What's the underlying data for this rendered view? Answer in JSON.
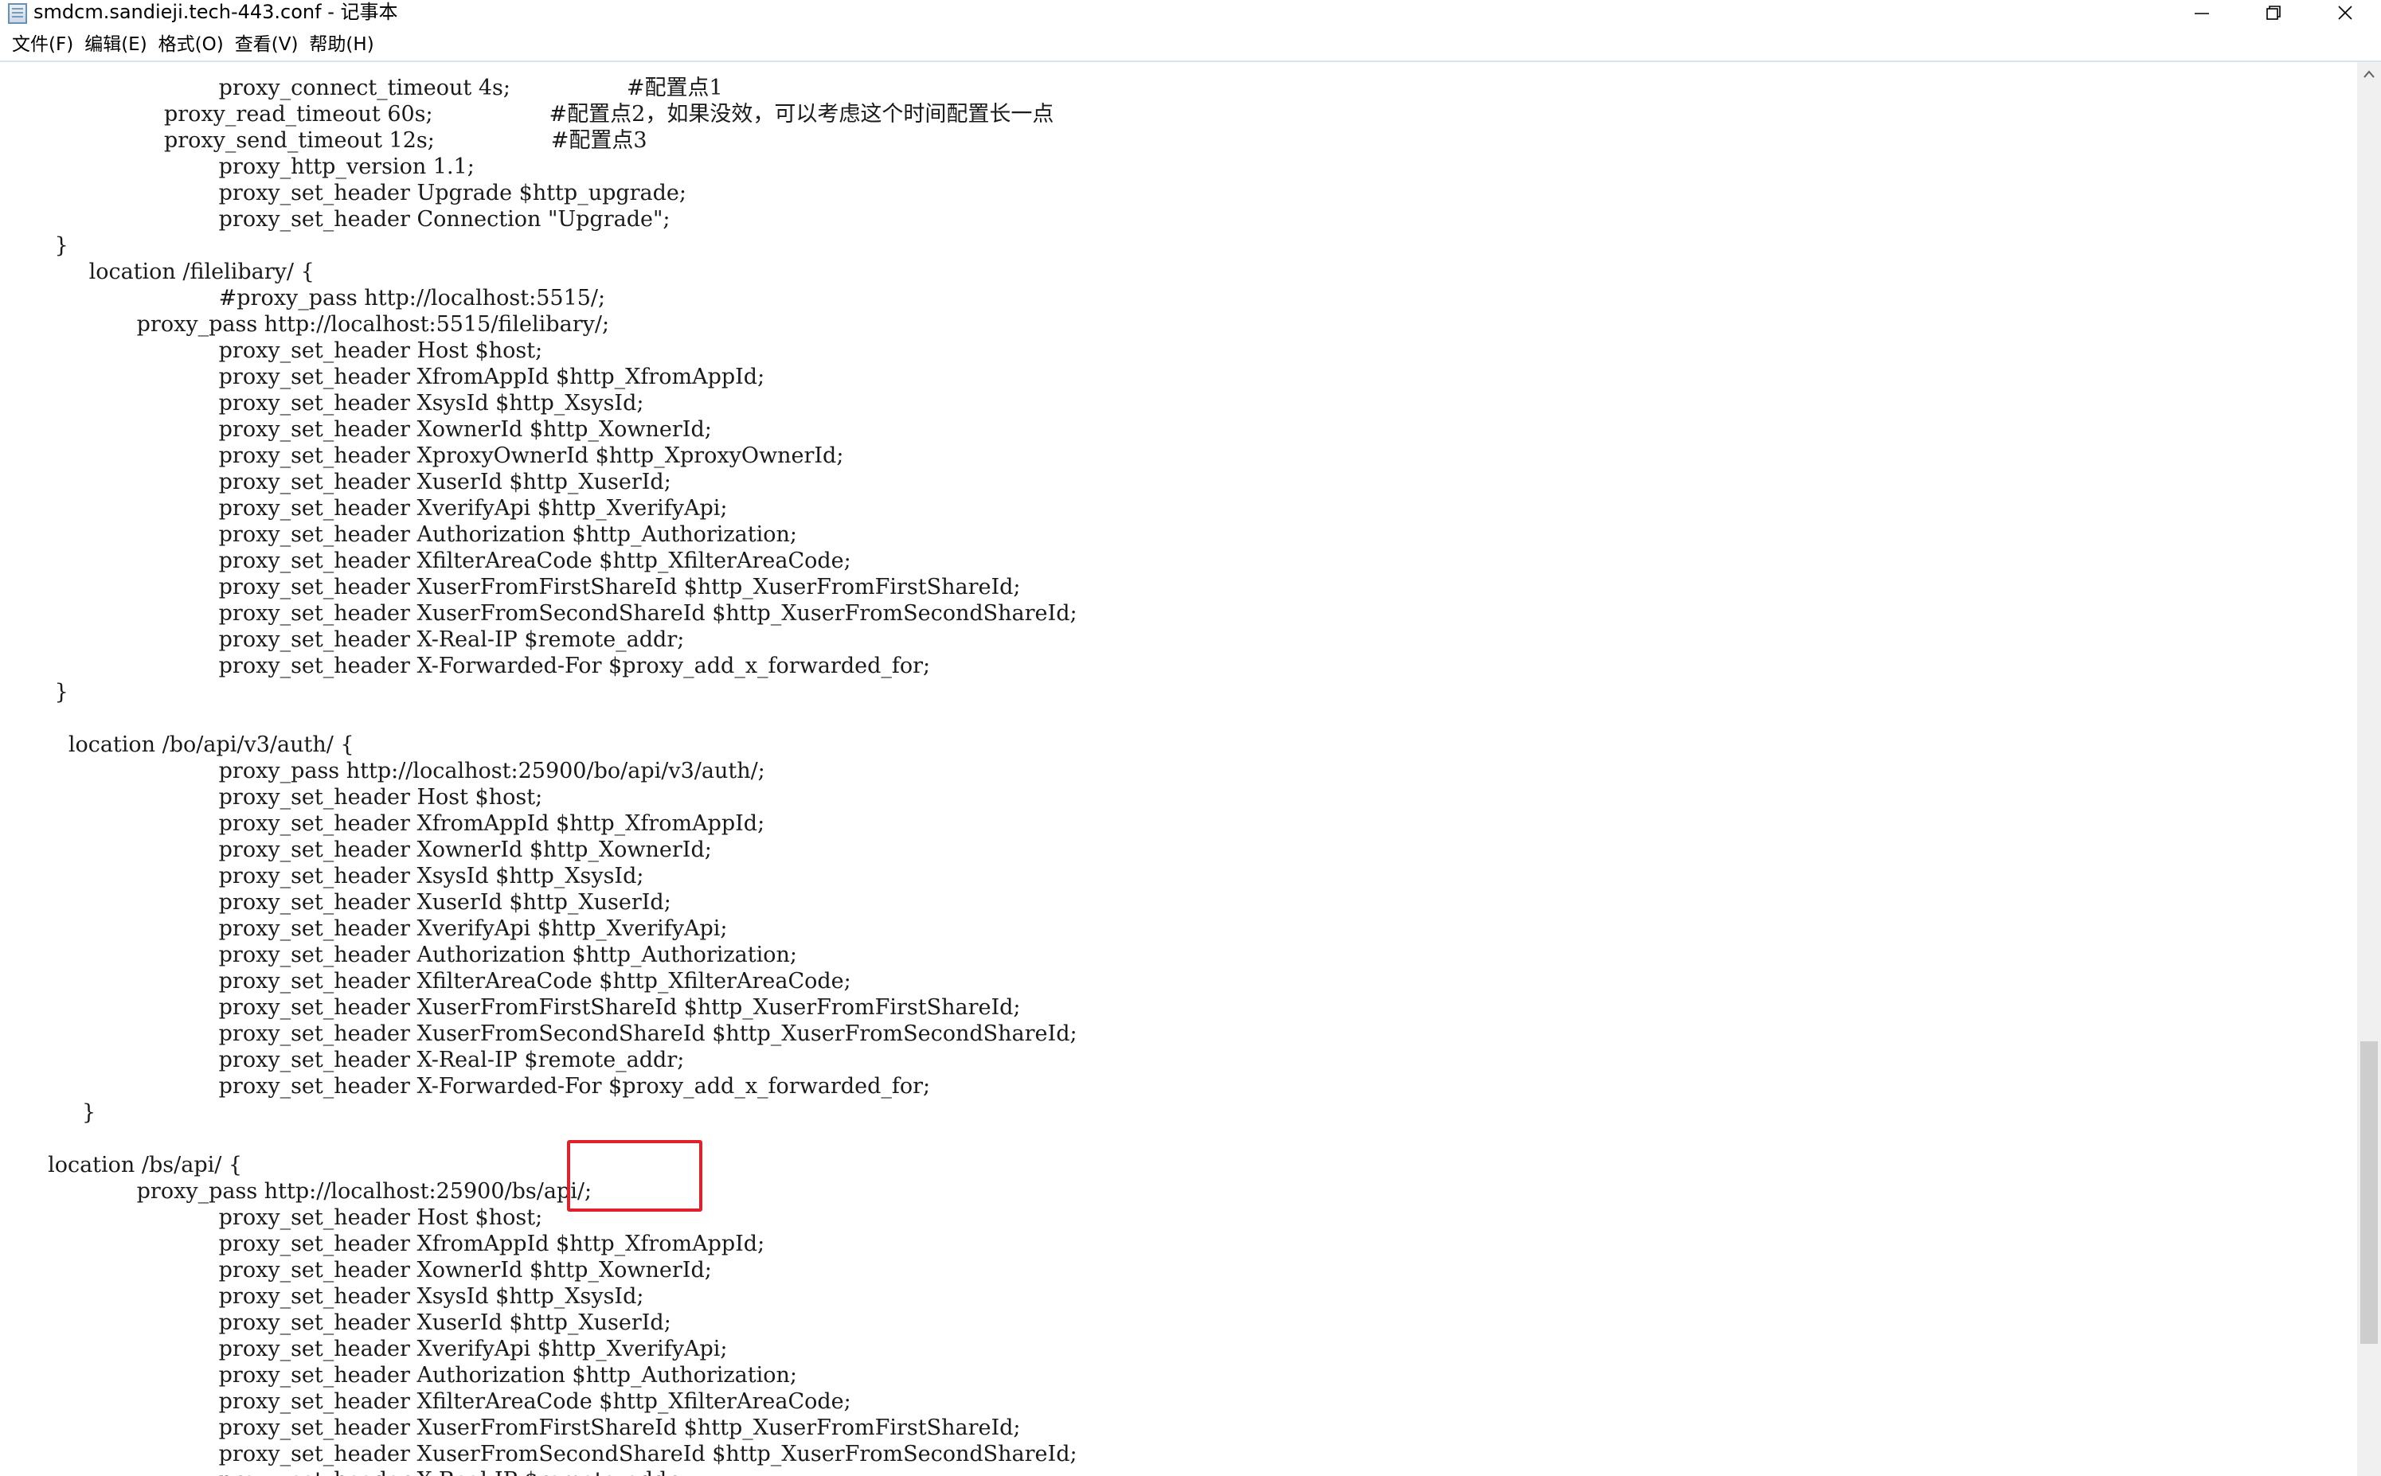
{
  "window": {
    "title": "smdcm.sandieji.tech-443.conf - 记事本",
    "icon": "notepad-icon",
    "controls": [
      "minimize-icon",
      "restore-icon",
      "close-icon"
    ]
  },
  "menu": {
    "items": [
      "文件(F)",
      "编辑(E)",
      "格式(O)",
      "查看(V)",
      "帮助(H)"
    ]
  },
  "editor": {
    "lines": [
      "                                proxy_connect_timeout 4s;                 #配置点1",
      "                        proxy_read_timeout 60s;                 #配置点2，如果没效，可以考虑这个时间配置长一点",
      "                        proxy_send_timeout 12s;                 #配置点3",
      "                                proxy_http_version 1.1;",
      "                                proxy_set_header Upgrade $http_upgrade;",
      "                                proxy_set_header Connection \"Upgrade\";",
      "        }",
      "             location /filelibary/ {",
      "                                #proxy_pass http://localhost:5515/;",
      "                    proxy_pass http://localhost:5515/filelibary/;",
      "                                proxy_set_header Host $host;",
      "                                proxy_set_header XfromAppId $http_XfromAppId;",
      "                                proxy_set_header XsysId $http_XsysId;",
      "                                proxy_set_header XownerId $http_XownerId;",
      "                                proxy_set_header XproxyOwnerId $http_XproxyOwnerId;",
      "                                proxy_set_header XuserId $http_XuserId;",
      "                                proxy_set_header XverifyApi $http_XverifyApi;",
      "                                proxy_set_header Authorization $http_Authorization;",
      "                                proxy_set_header XfilterAreaCode $http_XfilterAreaCode;",
      "                                proxy_set_header XuserFromFirstShareId $http_XuserFromFirstShareId;",
      "                                proxy_set_header XuserFromSecondShareId $http_XuserFromSecondShareId;",
      "                                proxy_set_header X-Real-IP $remote_addr;",
      "                                proxy_set_header X-Forwarded-For $proxy_add_x_forwarded_for;",
      "        }",
      "",
      "          location /bo/api/v3/auth/ {",
      "                                proxy_pass http://localhost:25900/bo/api/v3/auth/;",
      "                                proxy_set_header Host $host;",
      "                                proxy_set_header XfromAppId $http_XfromAppId;",
      "                                proxy_set_header XownerId $http_XownerId;",
      "                                proxy_set_header XsysId $http_XsysId;",
      "                                proxy_set_header XuserId $http_XuserId;",
      "                                proxy_set_header XverifyApi $http_XverifyApi;",
      "                                proxy_set_header Authorization $http_Authorization;",
      "                                proxy_set_header XfilterAreaCode $http_XfilterAreaCode;",
      "                                proxy_set_header XuserFromFirstShareId $http_XuserFromFirstShareId;",
      "                                proxy_set_header XuserFromSecondShareId $http_XuserFromSecondShareId;",
      "                                proxy_set_header X-Real-IP $remote_addr;",
      "                                proxy_set_header X-Forwarded-For $proxy_add_x_forwarded_for;",
      "            }",
      "",
      "       location /bs/api/ {",
      "                    proxy_pass http://localhost:25900/bs/api/;",
      "                                proxy_set_header Host $host;",
      "                                proxy_set_header XfromAppId $http_XfromAppId;",
      "                                proxy_set_header XownerId $http_XownerId;",
      "                                proxy_set_header XsysId $http_XsysId;",
      "                                proxy_set_header XuserId $http_XuserId;",
      "                                proxy_set_header XverifyApi $http_XverifyApi;",
      "                                proxy_set_header Authorization $http_Authorization;",
      "                                proxy_set_header XfilterAreaCode $http_XfilterAreaCode;",
      "                                proxy_set_header XuserFromFirstShareId $http_XuserFromFirstShareId;",
      "                                proxy_set_header XuserFromSecondShareId $http_XuserFromSecondShareId;",
      "                                proxy_set_header X-Real-IP $remote_addr;"
    ]
  },
  "annotation": {
    "highlight_color": "#e0202a"
  }
}
